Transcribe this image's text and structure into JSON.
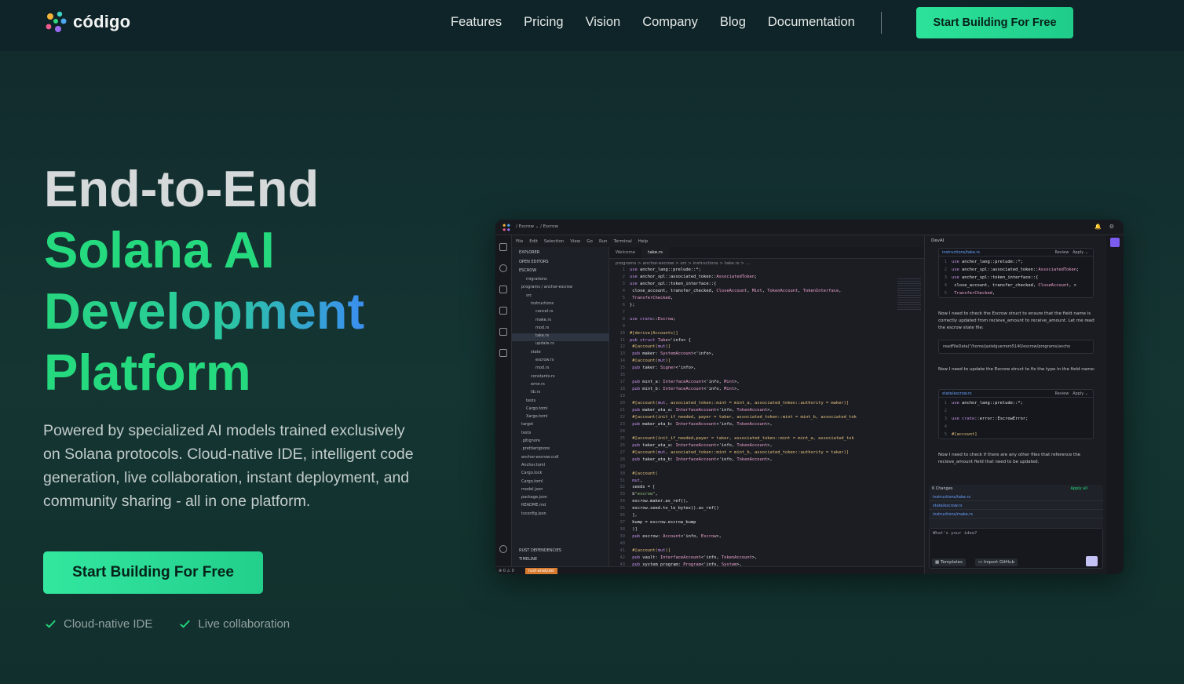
{
  "brand": {
    "name": "código",
    "colors": {
      "accent": "#25d97e",
      "accent_blue": "#3b8ef0",
      "bg": "#143532"
    }
  },
  "nav": {
    "links": [
      "Features",
      "Pricing",
      "Vision",
      "Company",
      "Blog",
      "Documentation"
    ],
    "cta": "Start Building For Free"
  },
  "hero": {
    "title": [
      "End-to-End",
      "Solana AI",
      "Development",
      "Platform"
    ],
    "subtitle": "Powered by specialized AI models trained exclusively on Solana protocols. Cloud-native IDE, intelligent code generation, live collaboration, instant deployment, and community sharing - all in one platform.",
    "cta": "Start Building For Free",
    "features": [
      "Cloud-native IDE",
      "Live collaboration"
    ]
  },
  "ide": {
    "top_crumb": "/ Escrow ⌄ / Escrow",
    "menu": [
      "File",
      "Edit",
      "Selection",
      "View",
      "Go",
      "Run",
      "Terminal",
      "Help"
    ],
    "explorer": {
      "header": "EXPLORER",
      "open_editors": "OPEN EDITORS",
      "project": "ESCROW",
      "items": [
        "migrations",
        "programs / anchor-escrow",
        "src",
        "instructions",
        "cancel.rs",
        "make.rs",
        "mod.rs",
        "take.rs",
        "update.rs",
        "state",
        "escrow.rs",
        "mod.rs",
        "constants.rs",
        "error.rs",
        "lib.rs",
        "tests",
        "Cargo.toml",
        "Xargo.toml",
        "target",
        "tests",
        ".gitignore",
        ".prettierignore",
        "anchor-escrow.ccdl",
        "Anchor.toml",
        "Cargo.lock",
        "Cargo.toml",
        "model.json",
        "package.json",
        "README.md",
        "tsconfig.json"
      ],
      "rust_deps": "RUST DEPENDENCIES",
      "timeline": "TIMELINE"
    },
    "tabs": [
      "Welcome",
      "take.rs"
    ],
    "breadcrumb": "programs > anchor-escrow > src > instructions > take.rs > ...",
    "code": [
      "use anchor_lang::prelude::*;",
      "use anchor_spl::associated_token::AssociatedToken;",
      "use anchor_spl::token_interface::{",
      "    close_account, transfer_checked, CloseAccount, Mint, TokenAccount, TokenInterface,",
      "    TransferChecked,",
      "};",
      "",
      "use crate::Escrow;",
      "",
      "#[derive(Accounts)]",
      "pub struct Take<'info> {",
      "    #[account(mut)]",
      "    pub maker: SystemAccount<'info>,",
      "    #[account(mut)]",
      "    pub taker: Signer<'info>,",
      "",
      "    pub mint_a: InterfaceAccount<'info, Mint>,",
      "    pub mint_b: InterfaceAccount<'info, Mint>,",
      "",
      "    #[account(mut, associated_token::mint = mint_a, associated_token::authority = maker)]",
      "    pub maker_ata_a: InterfaceAccount<'info, TokenAccount>,",
      "    #[account(init_if_needed, payer = taker, associated_token::mint = mint_b, associated_tok",
      "    pub maker_ata_b: InterfaceAccount<'info, TokenAccount>,",
      "",
      "    #[account(init_if_needed,payer = taker, associated_token::mint = mint_a, associated_tok",
      "    pub taker_ata_a: InterfaceAccount<'info, TokenAccount>,",
      "    #[account(mut, associated_token::mint = mint_b, associated_token::authority = taker)]",
      "    pub taker_ata_b: InterfaceAccount<'info, TokenAccount>,",
      "",
      "    #[account(",
      "        mut,",
      "        seeds = [",
      "            b\"escrow\",",
      "            escrow.maker.as_ref(),",
      "            escrow.seed.to_le_bytes().as_ref()",
      "        ],",
      "        bump = escrow.escrow_bump",
      "    )]",
      "    pub escrow: Account<'info, Escrow>,",
      "",
      "    #[account(mut)]",
      "    pub vault: InterfaceAccount<'info, TokenAccount>,",
      "    pub system_program: Program<'info, System>,"
    ],
    "ai": {
      "title": "DevAI",
      "card1": {
        "file": "instructions/take.rs",
        "review": "Review",
        "apply": "Apply",
        "lines": [
          "use anchor_lang::prelude::*;",
          "use anchor_spl::associated_token::AssociatedToken;",
          "use anchor_spl::token_interface::{",
          "    close_account, transfer_checked, CloseAccount, >",
          "    TransferChecked,"
        ]
      },
      "msg1": "Now I need to check the Escrow struct to ensure that the field name is correctly updated from recieve_amount to receive_amount. Let me read the escrow state file:",
      "tool_call": "readFileData(\"/home/jazielguerrero5140/escrow/programs/ancho",
      "msg2": "Now I need to update the Escrow struct to fix the typo in the field name:",
      "card2": {
        "file": "state/escrow.rs",
        "review": "Review",
        "apply": "Apply",
        "lines": [
          "use anchor_lang::prelude::*;",
          "",
          "use crate::error::EscrowError;",
          "",
          "#[account]"
        ]
      },
      "msg3": "Now I need to check if there are any other files that reference the recieve_amount field that need to be updated.",
      "changes": {
        "label": "6 Changes",
        "apply_all": "Apply all",
        "files": [
          "instructions/take.rs",
          "state/escrow.rs",
          "instructions/make.rs"
        ]
      },
      "input_placeholder": "What's your idea?",
      "templates": "Templates",
      "import": "Import GitHub"
    },
    "status_warning": "rust-analyzer",
    "status_counts": "⊗ 0 ⚠ 0"
  }
}
